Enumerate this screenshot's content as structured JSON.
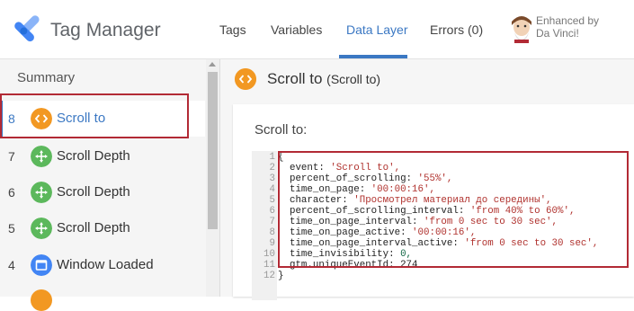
{
  "header": {
    "app_title": "Tag Manager",
    "tabs": [
      {
        "label": "Tags"
      },
      {
        "label": "Variables"
      },
      {
        "label": "Data Layer"
      },
      {
        "label": "Errors (0)"
      }
    ],
    "active_tab": "Data Layer",
    "enhanced_line1": "Enhanced by",
    "enhanced_line2": "Da Vinci!"
  },
  "sidebar": {
    "summary_label": "Summary",
    "events": [
      {
        "number": "8",
        "label": "Scroll to",
        "icon": "code-icon",
        "color": "#f29822",
        "selected": true
      },
      {
        "number": "7",
        "label": "Scroll Depth",
        "icon": "move-icon",
        "color": "#5cb85c"
      },
      {
        "number": "6",
        "label": "Scroll Depth",
        "icon": "move-icon",
        "color": "#5cb85c"
      },
      {
        "number": "5",
        "label": "Scroll Depth",
        "icon": "move-icon",
        "color": "#5cb85c"
      },
      {
        "number": "4",
        "label": "Window Loaded",
        "icon": "window-icon",
        "color": "#4285f4"
      }
    ]
  },
  "main": {
    "title": "Scroll to",
    "subtitle": "(Scroll to)",
    "card_label": "Scroll to:",
    "code_lines": [
      {
        "n": "1",
        "k": "{",
        "v": ""
      },
      {
        "n": "2",
        "k": "  event: ",
        "v": "'Scroll to',"
      },
      {
        "n": "3",
        "k": "  percent_of_scrolling: ",
        "v": "'55%',"
      },
      {
        "n": "4",
        "k": "  time_on_page: ",
        "v": "'00:00:16',"
      },
      {
        "n": "5",
        "k": "  character: ",
        "v": "'Просмотрел материал до середины',"
      },
      {
        "n": "6",
        "k": "  percent_of_scrolling_interval: ",
        "v": "'from 40% to 60%',"
      },
      {
        "n": "7",
        "k": "  time_on_page_interval: ",
        "v": "'from 0 sec to 30 sec',"
      },
      {
        "n": "8",
        "k": "  time_on_page_active: ",
        "v": "'00:00:16',"
      },
      {
        "n": "9",
        "k": "  time_on_page_interval_active: ",
        "v": "'from 0 sec to 30 sec',"
      },
      {
        "n": "10",
        "k": "  time_invisibility: ",
        "v": "0,"
      },
      {
        "n": "11",
        "k": "  gtm.uniqueEventId: ",
        "v": "274"
      },
      {
        "n": "12",
        "k": "}",
        "v": ""
      }
    ]
  },
  "colors": {
    "accent": "#3b78c3",
    "highlight": "#b22a35",
    "orange": "#f29822",
    "green": "#5cb85c"
  }
}
